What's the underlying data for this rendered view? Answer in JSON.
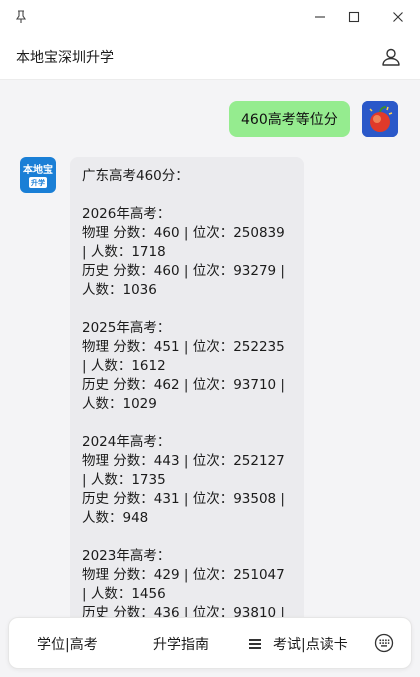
{
  "window": {
    "pin_icon": "pin-icon",
    "minimize_icon": "minimize-icon",
    "maximize_icon": "maximize-icon",
    "close_icon": "close-icon"
  },
  "header": {
    "title": "本地宝深圳升学",
    "user_icon": "user-icon"
  },
  "chat": {
    "user_message": "460高考等位分",
    "bot_avatar": {
      "line1": "本地宝",
      "line2": "升学"
    },
    "bot_lines": [
      "广东高考460分：",
      "",
      "2026年高考：",
      "物理 分数：460 | 位次：250839 | 人数：1718",
      "历史 分数：460 | 位次：93279 | 人数：1036",
      "",
      "2025年高考：",
      "物理 分数：451 | 位次：252235 | 人数：1612",
      "历史 分数：462 | 位次：93710 | 人数：1029",
      "",
      "2024年高考：",
      "物理 分数：443 | 位次：252127 | 人数：1735",
      "历史 分数：431 | 位次：93508 | 人数：948",
      "",
      "2023年高考：",
      "物理 分数：429 | 位次：251047 | 人数：1456",
      "历史 分数：436 | 位次：93810 |"
    ]
  },
  "bottom_bar": {
    "item1": "学位|高考",
    "item2": "升学指南",
    "item3": "考试|点读卡",
    "menu_icon": "menu-icon",
    "keyboard_icon": "keyboard-icon"
  },
  "colors": {
    "user_bubble": "#95ec8f",
    "bot_bubble": "#ebebee",
    "background": "#f4f4f6"
  }
}
